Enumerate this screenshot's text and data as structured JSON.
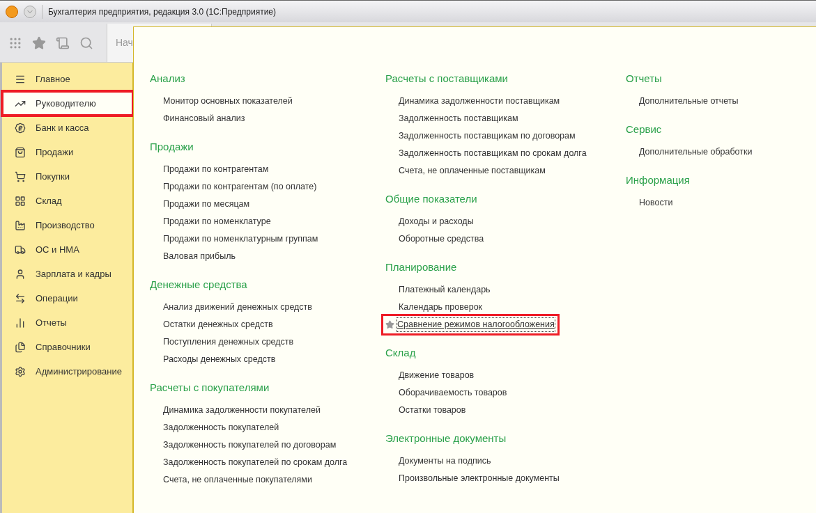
{
  "window": {
    "title": "Бухгалтерия предприятия, редакция 3.0  (1С:Предприятие)"
  },
  "toolbar": {
    "tab_label": "Нач"
  },
  "sidebar": {
    "items": [
      {
        "label": "Главное",
        "selected": false
      },
      {
        "label": "Руководителю",
        "selected": true
      },
      {
        "label": "Банк и касса",
        "selected": false
      },
      {
        "label": "Продажи",
        "selected": false
      },
      {
        "label": "Покупки",
        "selected": false
      },
      {
        "label": "Склад",
        "selected": false
      },
      {
        "label": "Производство",
        "selected": false
      },
      {
        "label": "ОС и НМА",
        "selected": false
      },
      {
        "label": "Зарплата и кадры",
        "selected": false
      },
      {
        "label": "Операции",
        "selected": false
      },
      {
        "label": "Отчеты",
        "selected": false
      },
      {
        "label": "Справочники",
        "selected": false
      },
      {
        "label": "Администрирование",
        "selected": false
      }
    ]
  },
  "columns": [
    {
      "sections": [
        {
          "title": "Анализ",
          "links": [
            {
              "label": "Монитор основных показателей",
              "focused": false
            },
            {
              "label": "Финансовый анализ",
              "focused": false
            }
          ]
        },
        {
          "title": "Продажи",
          "links": [
            {
              "label": "Продажи по контрагентам",
              "focused": false
            },
            {
              "label": "Продажи по контрагентам (по оплате)",
              "focused": false
            },
            {
              "label": "Продажи по месяцам",
              "focused": false
            },
            {
              "label": "Продажи по номенклатуре",
              "focused": false
            },
            {
              "label": "Продажи по номенклатурным группам",
              "focused": false
            },
            {
              "label": "Валовая прибыль",
              "focused": false
            }
          ]
        },
        {
          "title": "Денежные средства",
          "links": [
            {
              "label": "Анализ движений денежных средств",
              "focused": false
            },
            {
              "label": "Остатки денежных средств",
              "focused": false
            },
            {
              "label": "Поступления денежных средств",
              "focused": false
            },
            {
              "label": "Расходы денежных средств",
              "focused": false
            }
          ]
        },
        {
          "title": "Расчеты с покупателями",
          "links": [
            {
              "label": "Динамика задолженности покупателей",
              "focused": false
            },
            {
              "label": "Задолженность покупателей",
              "focused": false
            },
            {
              "label": "Задолженность покупателей по договорам",
              "focused": false
            },
            {
              "label": "Задолженность покупателей по срокам долга",
              "focused": false
            },
            {
              "label": "Счета, не оплаченные покупателями",
              "focused": false
            }
          ]
        }
      ]
    },
    {
      "sections": [
        {
          "title": "Расчеты с поставщиками",
          "links": [
            {
              "label": "Динамика задолженности поставщикам",
              "focused": false
            },
            {
              "label": "Задолженность поставщикам",
              "focused": false
            },
            {
              "label": "Задолженность поставщикам по договорам",
              "focused": false
            },
            {
              "label": "Задолженность поставщикам по срокам долга",
              "focused": false
            },
            {
              "label": "Счета, не оплаченные поставщикам",
              "focused": false
            }
          ]
        },
        {
          "title": "Общие показатели",
          "links": [
            {
              "label": "Доходы и расходы",
              "focused": false
            },
            {
              "label": "Оборотные средства",
              "focused": false
            }
          ]
        },
        {
          "title": "Планирование",
          "links": [
            {
              "label": "Платежный календарь",
              "focused": false
            },
            {
              "label": "Календарь проверок",
              "focused": false
            },
            {
              "label": "Сравнение режимов налогообложения",
              "focused": true
            }
          ]
        },
        {
          "title": "Склад",
          "links": [
            {
              "label": "Движение товаров",
              "focused": false
            },
            {
              "label": "Оборачиваемость товаров",
              "focused": false
            },
            {
              "label": "Остатки товаров",
              "focused": false
            }
          ]
        },
        {
          "title": "Электронные документы",
          "links": [
            {
              "label": "Документы на подпись",
              "focused": false
            },
            {
              "label": "Произвольные электронные документы",
              "focused": false
            }
          ]
        }
      ]
    },
    {
      "sections": [
        {
          "title": "Отчеты",
          "links": [
            {
              "label": "Дополнительные отчеты",
              "focused": false
            }
          ]
        },
        {
          "title": "Сервис",
          "links": [
            {
              "label": "Дополнительные обработки",
              "focused": false
            }
          ]
        },
        {
          "title": "Информация",
          "links": [
            {
              "label": "Новости",
              "focused": false
            }
          ]
        }
      ]
    }
  ]
}
